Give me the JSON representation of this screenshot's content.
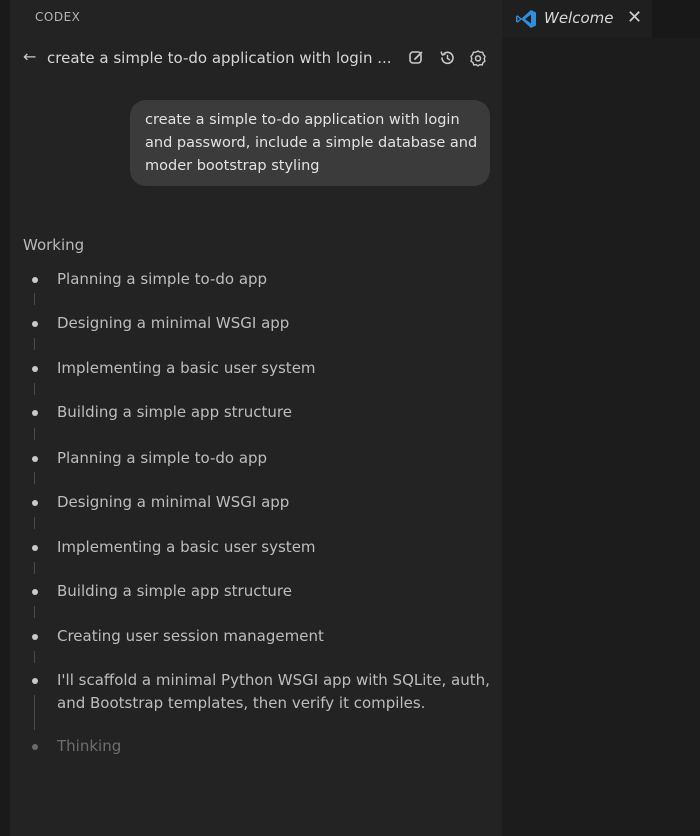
{
  "panel": {
    "title": "CODEX",
    "thread_title": "create a simple to-do application with login ...",
    "header_icons": [
      "edit-icon",
      "history-icon",
      "settings-icon"
    ]
  },
  "editor_tab": {
    "label": "Welcome",
    "close_label": "✕"
  },
  "user_message": {
    "lines": [
      "create a simple to-do application with login",
      "and password, include a simple database and",
      "moder bootstrap styling"
    ]
  },
  "status": "Working",
  "steps": [
    {
      "text": "Planning a simple to-do app"
    },
    {
      "text": "Designing a minimal WSGI app"
    },
    {
      "text": "Implementing a basic user system"
    },
    {
      "text": "Building a simple app structure"
    },
    {
      "text": "Planning a simple to-do app"
    },
    {
      "text": "Designing a minimal WSGI app"
    },
    {
      "text": "Implementing a basic user system"
    },
    {
      "text": "Building a simple app structure"
    },
    {
      "text": "Creating user session management"
    },
    {
      "text": "I'll scaffold a minimal Python WSGI app with SQLite, auth,",
      "text2": "and Bootstrap templates, then verify it compiles."
    },
    {
      "text": "Thinking"
    }
  ],
  "colors": {
    "panel_bg": "#232323",
    "bubble_bg": "#3b3b3b",
    "vscode_blue": "#2d8fe0"
  }
}
